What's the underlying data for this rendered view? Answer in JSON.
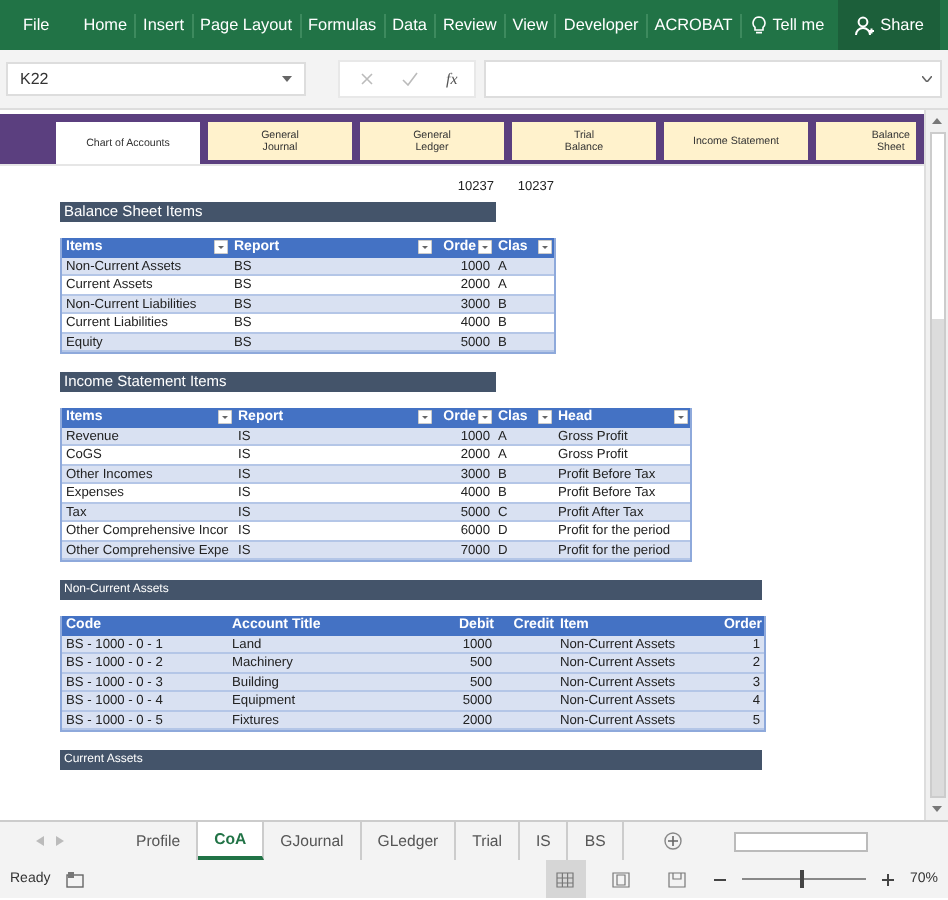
{
  "ribbon": {
    "tabs": [
      "File",
      "Home",
      "Insert",
      "Page Layout",
      "Formulas",
      "Data",
      "Review",
      "View",
      "Developer",
      "ACROBAT"
    ],
    "tell_me": "Tell me",
    "share": "Share"
  },
  "formula_bar": {
    "name_box": "K22",
    "function_label": "fx"
  },
  "nav_tabs": [
    {
      "label": "Chart of Accounts",
      "selected": true
    },
    {
      "label": "General\nJournal",
      "selected": false
    },
    {
      "label": "General\nLedger",
      "selected": false
    },
    {
      "label": "Trial\nBalance",
      "selected": false
    },
    {
      "label": "Income Statement",
      "selected": false
    },
    {
      "label": "Balance\nSheet",
      "selected": false
    }
  ],
  "header_numbers": [
    "10237",
    "10237"
  ],
  "sections": [
    {
      "title": "Balance Sheet Items",
      "table": {
        "banded": true,
        "columns": [
          {
            "label": "Items",
            "filter": true,
            "numeric": false
          },
          {
            "label": "Report",
            "filter": true,
            "numeric": false
          },
          {
            "label": "Orde",
            "filter": true,
            "numeric": true
          },
          {
            "label": "Clas",
            "filter": true,
            "numeric": false
          }
        ],
        "rows": [
          [
            "Non-Current Assets",
            "BS",
            "1000",
            "A"
          ],
          [
            "Current Assets",
            "BS",
            "2000",
            "A"
          ],
          [
            "Non-Current Liabilities",
            "BS",
            "3000",
            "B"
          ],
          [
            "Current Liabilities",
            "BS",
            "4000",
            "B"
          ],
          [
            "Equity",
            "BS",
            "5000",
            "B"
          ]
        ]
      }
    },
    {
      "title": "Income Statement Items",
      "table": {
        "banded": true,
        "columns": [
          {
            "label": "Items",
            "filter": true,
            "numeric": false
          },
          {
            "label": "Report",
            "filter": true,
            "numeric": false
          },
          {
            "label": "Orde",
            "filter": true,
            "numeric": true
          },
          {
            "label": "Clas",
            "filter": true,
            "numeric": false
          },
          {
            "label": "Head",
            "filter": true,
            "numeric": false
          }
        ],
        "rows": [
          [
            "Revenue",
            "IS",
            "1000",
            "A",
            "Gross Profit"
          ],
          [
            "CoGS",
            "IS",
            "2000",
            "A",
            "Gross Profit"
          ],
          [
            "Other Incomes",
            "IS",
            "3000",
            "B",
            "Profit Before Tax"
          ],
          [
            "Expenses",
            "IS",
            "4000",
            "B",
            "Profit Before Tax"
          ],
          [
            "Tax",
            "IS",
            "5000",
            "C",
            "Profit After Tax"
          ],
          [
            "Other Comprehensive Incor",
            "IS",
            "6000",
            "D",
            "Profit for the period"
          ],
          [
            "Other Comprehensive Expe",
            "IS",
            "7000",
            "D",
            "Profit for the period"
          ]
        ]
      }
    },
    {
      "title": "Non-Current Assets",
      "table": {
        "banded": false,
        "columns": [
          {
            "label": "Code",
            "filter": false,
            "numeric": false
          },
          {
            "label": "Account Title",
            "filter": false,
            "numeric": false
          },
          {
            "label": "Debit",
            "filter": false,
            "numeric": true
          },
          {
            "label": "Credit",
            "filter": false,
            "numeric": true
          },
          {
            "label": "Item",
            "filter": false,
            "numeric": false
          },
          {
            "label": "Order",
            "filter": false,
            "numeric": true
          }
        ],
        "rows": [
          [
            "BS - 1000 - 0 - 1",
            "Land",
            "1000",
            "",
            "Non-Current Assets",
            "1"
          ],
          [
            "BS - 1000 - 0 - 2",
            "Machinery",
            "500",
            "",
            "Non-Current Assets",
            "2"
          ],
          [
            "BS - 1000 - 0 - 3",
            "Building",
            "500",
            "",
            "Non-Current Assets",
            "3"
          ],
          [
            "BS - 1000 - 0 - 4",
            "Equipment",
            "5000",
            "",
            "Non-Current Assets",
            "4"
          ],
          [
            "BS - 1000 - 0 - 5",
            "Fixtures",
            "2000",
            "",
            "Non-Current Assets",
            "5"
          ]
        ]
      }
    },
    {
      "title": "Current Assets"
    }
  ],
  "sheet_tabs": [
    {
      "label": "Profile",
      "selected": false
    },
    {
      "label": "CoA",
      "selected": true
    },
    {
      "label": "GJournal",
      "selected": false
    },
    {
      "label": "GLedger",
      "selected": false
    },
    {
      "label": "Trial",
      "selected": false
    },
    {
      "label": "IS",
      "selected": false
    },
    {
      "label": "BS",
      "selected": false
    }
  ],
  "status_bar": {
    "status": "Ready",
    "view_modes": [
      {
        "kind": "normal",
        "selected": true
      },
      {
        "kind": "page-layout",
        "selected": false
      },
      {
        "kind": "page-break",
        "selected": false
      }
    ],
    "zoom": {
      "level": 0.47,
      "reading": "70%"
    }
  }
}
